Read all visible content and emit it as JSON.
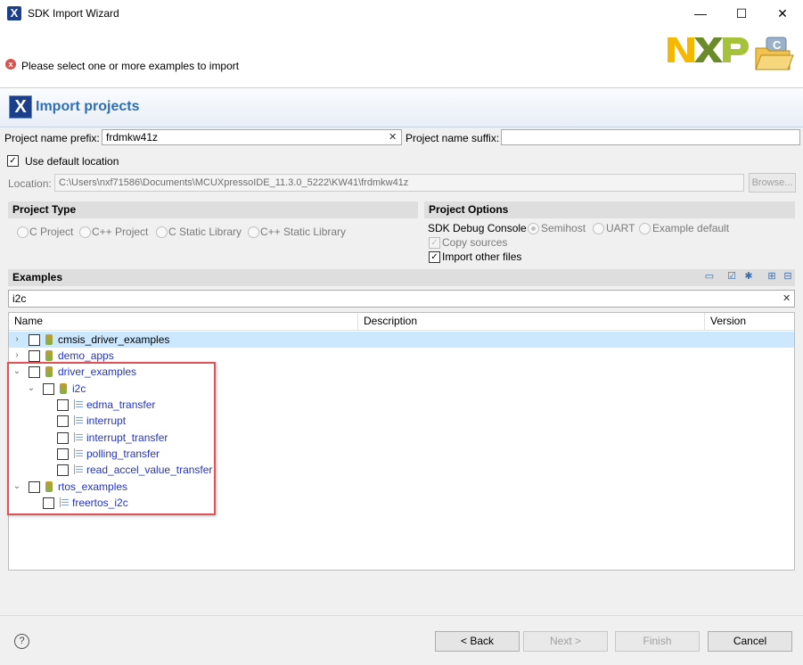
{
  "window": {
    "title": "SDK Import Wizard",
    "controls": {
      "minimize": "—",
      "maximize": "☐",
      "close": "✕"
    }
  },
  "message": {
    "text": "Please select one or more examples to import",
    "icon": "error-icon",
    "icon_color": "#d9534f"
  },
  "branding": {
    "logo_text": "NXP",
    "letter": "C"
  },
  "page": {
    "title": "Import projects",
    "title_color": "#2d6fb3"
  },
  "form": {
    "prefix_label": "Project name prefix:",
    "prefix_value": "frdmkw41z",
    "clear_glyph": "✕",
    "suffix_label": "Project name suffix:",
    "suffix_value": "",
    "use_default_location_label": "Use default location",
    "use_default_location_checked": true,
    "location_label": "Location:",
    "location_value": "C:\\Users\\nxf71586\\Documents\\MCUXpressoIDE_11.3.0_5222\\KW41\\frdmkw41z",
    "browse_label": "Browse..."
  },
  "project_type": {
    "heading": "Project Type",
    "options": [
      "C Project",
      "C++ Project",
      "C Static Library",
      "C++ Static Library"
    ]
  },
  "project_options": {
    "heading": "Project Options",
    "debug_console_label": "SDK Debug Console",
    "debug_console_options": [
      "Semihost",
      "UART",
      "Example default"
    ],
    "debug_console_selected": "Semihost",
    "copy_sources_label": "Copy sources",
    "copy_sources_checked": true,
    "import_other_files_label": "Import other files",
    "import_other_files_checked": true
  },
  "examples": {
    "heading": "Examples",
    "filter_value": "i2c",
    "toolbar_icons": [
      "import-icon",
      "check-all-icon",
      "uncheck-all-icon",
      "expand-all-icon",
      "collapse-all-icon"
    ],
    "columns": [
      "Name",
      "Description",
      "Version"
    ],
    "tree": [
      {
        "label": "cmsis_driver_examples",
        "expander": "›",
        "kind": "group",
        "selected": true
      },
      {
        "label": "demo_apps",
        "expander": "›",
        "kind": "group"
      },
      {
        "label": "driver_examples",
        "expander": "⌄",
        "kind": "group"
      },
      {
        "label": "i2c",
        "expander": "⌄",
        "kind": "group"
      },
      {
        "label": "edma_transfer",
        "kind": "file"
      },
      {
        "label": "interrupt",
        "kind": "file"
      },
      {
        "label": "interrupt_transfer",
        "kind": "file"
      },
      {
        "label": "polling_transfer",
        "kind": "file"
      },
      {
        "label": "read_accel_value_transfer",
        "kind": "file"
      },
      {
        "label": "rtos_examples",
        "expander": "⌄",
        "kind": "group"
      },
      {
        "label": "freertos_i2c",
        "kind": "file"
      }
    ],
    "highlight_color": "#e05257"
  },
  "footer": {
    "help_glyph": "?",
    "back_label": "< Back",
    "next_label": "Next >",
    "finish_label": "Finish",
    "cancel_label": "Cancel"
  }
}
